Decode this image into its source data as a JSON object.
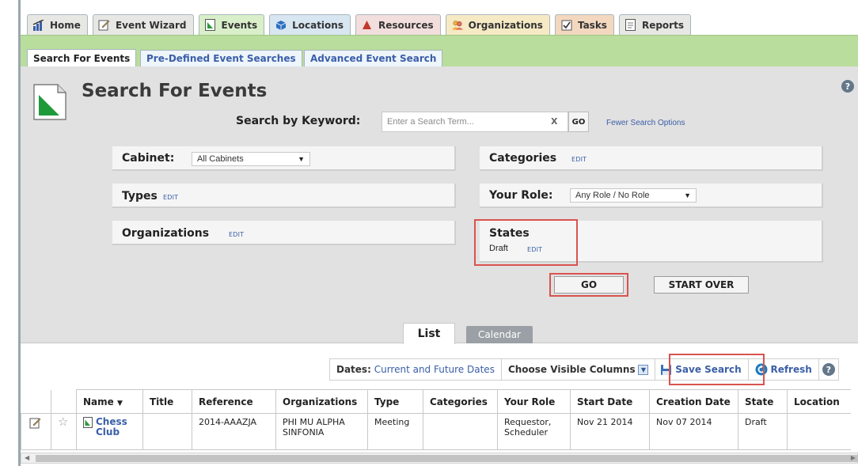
{
  "top_tabs": [
    {
      "label": "Home",
      "icon": "home-icon"
    },
    {
      "label": "Event Wizard",
      "icon": "pencil-icon"
    },
    {
      "label": "Events",
      "icon": "event-document-icon"
    },
    {
      "label": "Locations",
      "icon": "cube-icon"
    },
    {
      "label": "Resources",
      "icon": "triangle-icon"
    },
    {
      "label": "Organizations",
      "icon": "people-icon"
    },
    {
      "label": "Tasks",
      "icon": "checkbox-icon"
    },
    {
      "label": "Reports",
      "icon": "report-icon"
    }
  ],
  "sub_tabs": [
    "Search For Events",
    "Pre-Defined Event Searches",
    "Advanced Event Search"
  ],
  "page_title": "Search For Events",
  "help": "?",
  "keyword": {
    "label": "Search by Keyword:",
    "placeholder": "Enter a Search Term...",
    "clear": "X",
    "go": "GO",
    "fewer_options": "Fewer Search Options"
  },
  "filters": {
    "cabinet_label": "Cabinet:",
    "cabinet_value": "All Cabinets",
    "types_label": "Types",
    "organizations_label": "Organizations",
    "categories_label": "Categories",
    "your_role_label": "Your Role:",
    "your_role_value": "Any Role / No Role",
    "states_label": "States",
    "states_value": "Draft",
    "edit": "EDIT"
  },
  "buttons": {
    "go": "GO",
    "start_over": "START OVER"
  },
  "view_tabs": {
    "list": "List",
    "calendar": "Calendar"
  },
  "toolbar": {
    "dates_label": "Dates:",
    "dates_value": "Current and Future Dates",
    "choose_columns": "Choose Visible Columns",
    "save_search": "Save Search",
    "refresh": "Refresh"
  },
  "table": {
    "columns": [
      "Name",
      "Title",
      "Reference",
      "Organizations",
      "Type",
      "Categories",
      "Your Role",
      "Start Date",
      "Creation Date",
      "State",
      "Location"
    ],
    "rows": [
      {
        "name": "Chess Club",
        "title": "",
        "reference": "2014-AAAZJA",
        "organizations": "PHI MU ALPHA SINFONIA",
        "type": "Meeting",
        "categories": "",
        "your_role": "Requestor, Scheduler",
        "start_date": "Nov 21 2014",
        "creation_date": "Nov 07 2014",
        "state": "Draft",
        "location": ""
      }
    ]
  },
  "colors": {
    "accent_green": "#b9dd9d",
    "link_blue": "#3a5ea8",
    "highlight_red": "#d9534f"
  }
}
